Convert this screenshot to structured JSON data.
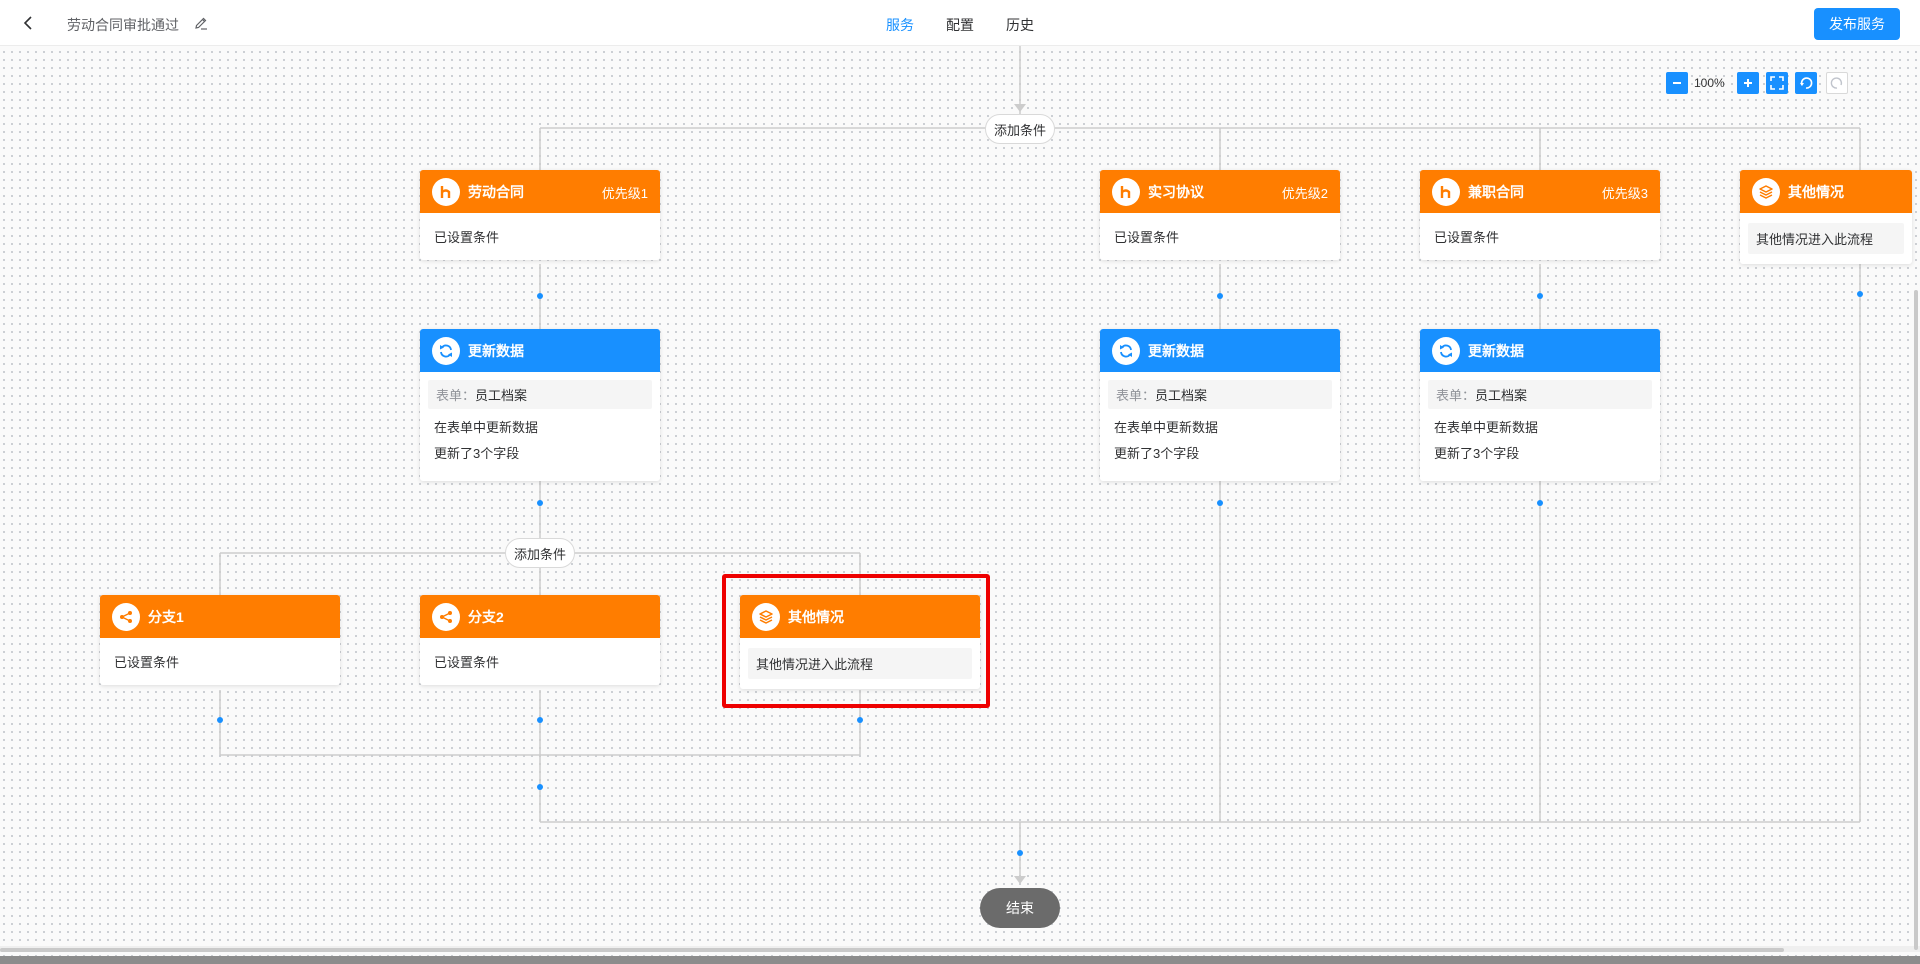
{
  "header": {
    "title": "劳动合同审批通过",
    "tabs": [
      {
        "label": "服务",
        "active": true
      },
      {
        "label": "配置",
        "active": false
      },
      {
        "label": "历史",
        "active": false
      }
    ],
    "publish_label": "发布服务"
  },
  "zoom": {
    "level": "100%"
  },
  "colors": {
    "condition": "#ff7d00",
    "action": "#1890ff",
    "accent": "#1890ff",
    "highlight": "#e00000"
  },
  "add_condition_label": "添加条件",
  "end_label": "结束",
  "branches": [
    {
      "title": "劳动合同",
      "priority": "优先级1",
      "condition": "已设置条件",
      "icon": "contract-icon"
    },
    {
      "title": "实习协议",
      "priority": "优先级2",
      "condition": "已设置条件",
      "icon": "contract-icon"
    },
    {
      "title": "兼职合同",
      "priority": "优先级3",
      "condition": "已设置条件",
      "icon": "contract-icon"
    },
    {
      "title": "其他情况",
      "condition": "其他情况进入此流程",
      "icon": "layers-icon"
    }
  ],
  "update_nodes": [
    {
      "title": "更新数据",
      "form_key": "表单：",
      "form_value": "员工档案",
      "line1": "在表单中更新数据",
      "line2": "更新了3个字段"
    },
    {
      "title": "更新数据",
      "form_key": "表单：",
      "form_value": "员工档案",
      "line1": "在表单中更新数据",
      "line2": "更新了3个字段"
    },
    {
      "title": "更新数据",
      "form_key": "表单：",
      "form_value": "员工档案",
      "line1": "在表单中更新数据",
      "line2": "更新了3个字段"
    }
  ],
  "sub_branches": [
    {
      "title": "分支1",
      "condition": "已设置条件",
      "icon": "share-icon"
    },
    {
      "title": "分支2",
      "condition": "已设置条件",
      "icon": "share-icon"
    },
    {
      "title": "其他情况",
      "condition": "其他情况进入此流程",
      "icon": "layers-icon"
    }
  ]
}
